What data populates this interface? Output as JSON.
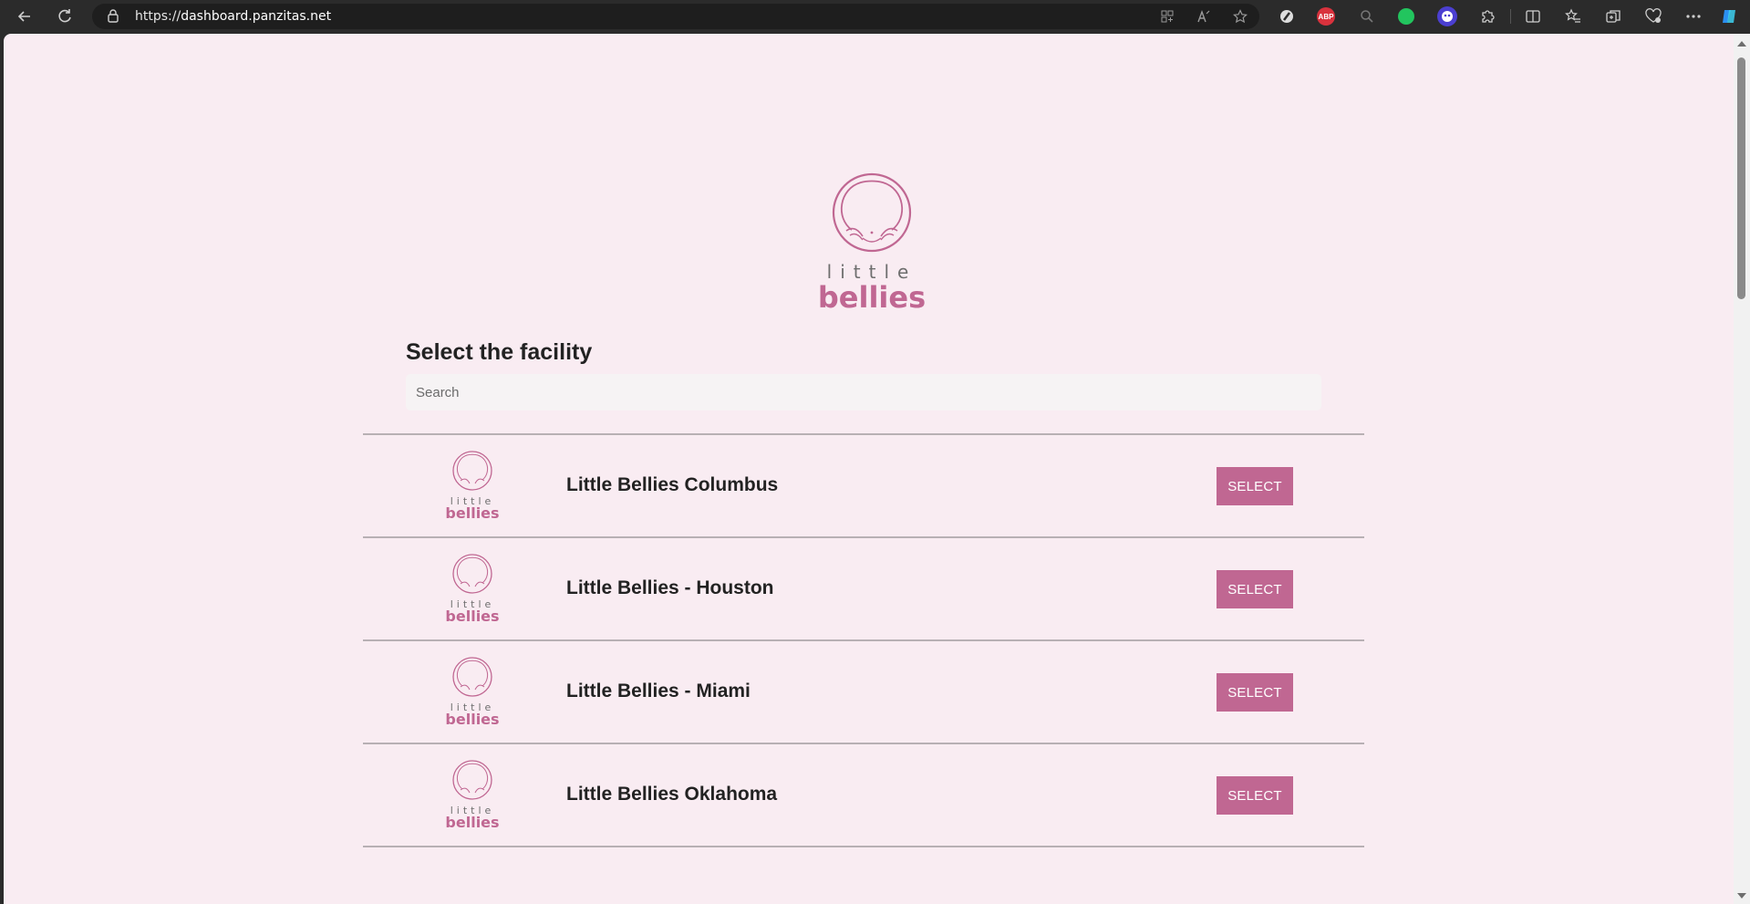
{
  "browser": {
    "url_scheme": "https://",
    "url_host": "dashboard.panzitas.net",
    "extensions": {
      "abp_label": "ABP"
    }
  },
  "brand": {
    "logo_top": "little",
    "logo_bottom": "bellies",
    "color": "#c06792"
  },
  "page": {
    "heading": "Select the facility",
    "search_placeholder": "Search"
  },
  "facilities": [
    {
      "name": "Little Bellies Columbus",
      "button": "SELECT"
    },
    {
      "name": "Little Bellies - Houston",
      "button": "SELECT"
    },
    {
      "name": "Little Bellies - Miami",
      "button": "SELECT"
    },
    {
      "name": "Little Bellies Oklahoma",
      "button": "SELECT"
    }
  ]
}
